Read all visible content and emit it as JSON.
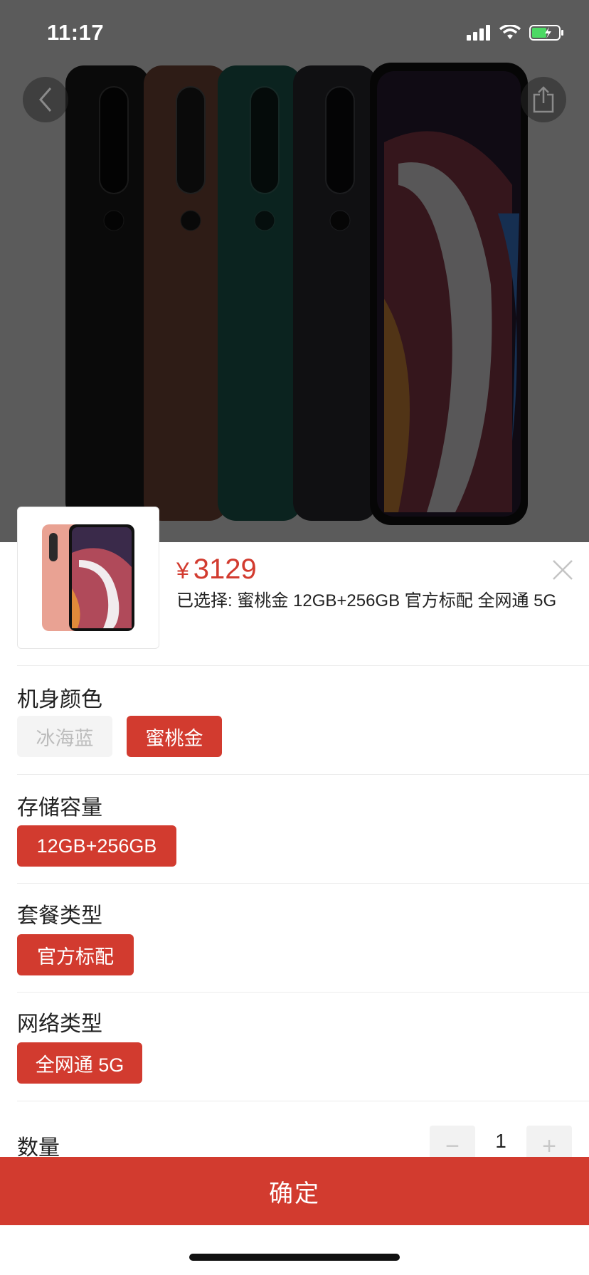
{
  "status_bar": {
    "time": "11:17"
  },
  "product": {
    "price_symbol": "¥",
    "price": "3129",
    "selected_text": "已选择: 蜜桃金 12GB+256GB 官方标配 全网通 5G"
  },
  "sections": [
    {
      "title": "机身颜色",
      "options": [
        {
          "label": "冰海蓝",
          "state": "disabled"
        },
        {
          "label": "蜜桃金",
          "state": "selected"
        }
      ]
    },
    {
      "title": "存储容量",
      "options": [
        {
          "label": "12GB+256GB",
          "state": "selected"
        }
      ]
    },
    {
      "title": "套餐类型",
      "options": [
        {
          "label": "官方标配",
          "state": "selected"
        }
      ]
    },
    {
      "title": "网络类型",
      "options": [
        {
          "label": "全网通 5G",
          "state": "selected"
        }
      ]
    }
  ],
  "quantity": {
    "label": "数量",
    "value": "1",
    "minus": "−",
    "plus": "+"
  },
  "confirm_label": "确定",
  "colors": {
    "accent": "#d23b2f",
    "disabled_bg": "#f4f4f4",
    "disabled_text": "#bcbcbc"
  },
  "icons": [
    "back-arrow-icon",
    "share-icon",
    "close-icon",
    "signal-icon",
    "wifi-icon",
    "battery-icon"
  ]
}
